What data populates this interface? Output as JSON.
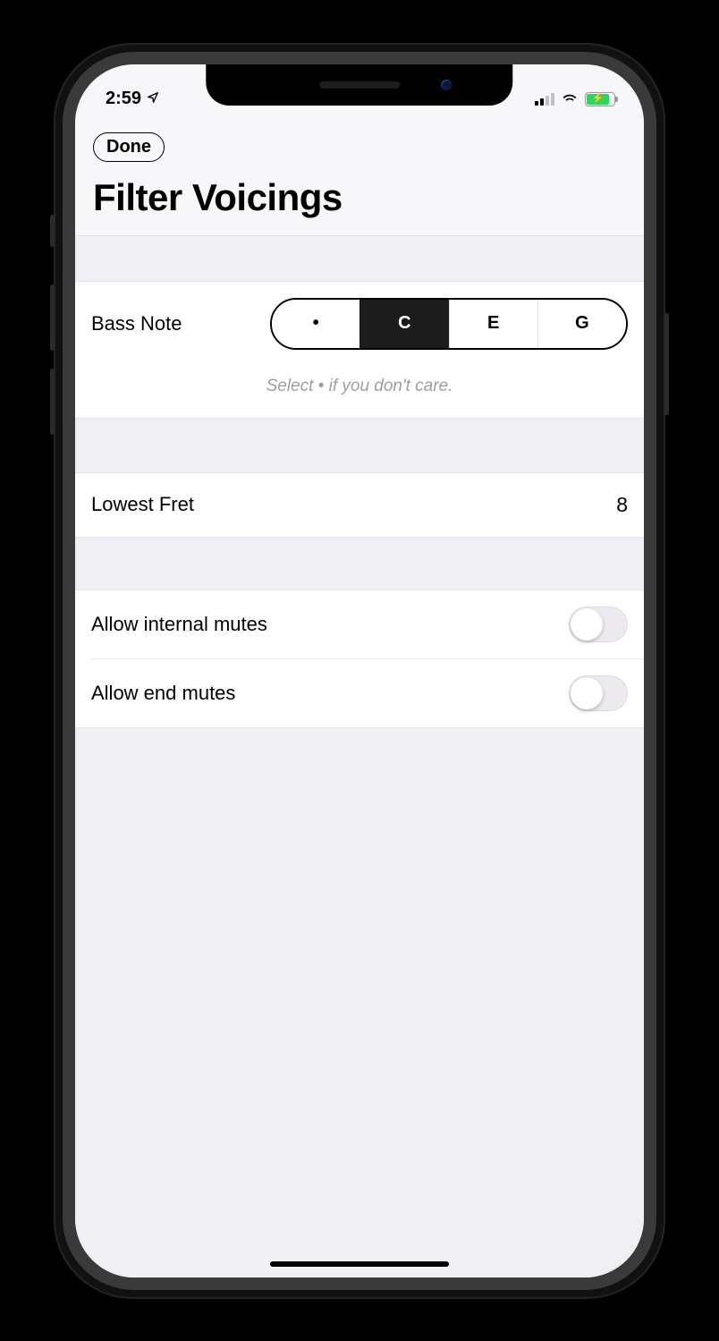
{
  "status": {
    "time": "2:59"
  },
  "nav": {
    "done_label": "Done",
    "title": "Filter Voicings"
  },
  "bass_note": {
    "label": "Bass Note",
    "options": [
      "•",
      "C",
      "E",
      "G"
    ],
    "selected_index": 1,
    "hint": "Select • if you don't care."
  },
  "lowest_fret": {
    "label": "Lowest Fret",
    "value": "8"
  },
  "toggles": {
    "internal_mutes": {
      "label": "Allow internal mutes",
      "on": false
    },
    "end_mutes": {
      "label": "Allow end mutes",
      "on": false
    }
  }
}
